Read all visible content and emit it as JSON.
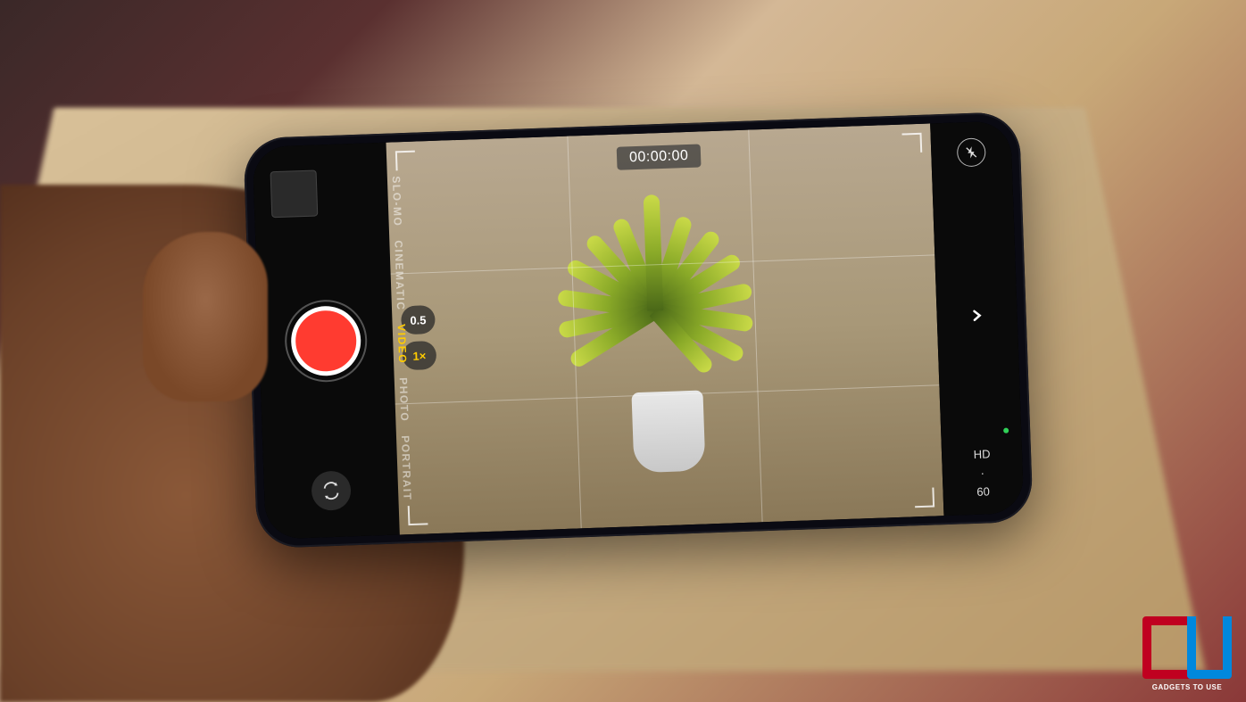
{
  "camera": {
    "timer": "00:00:00",
    "modes": {
      "slomo": "SLO-MO",
      "cinematic": "CINEMATIC",
      "video": "VIDEO",
      "photo": "PHOTO",
      "portrait": "PORTRAIT"
    },
    "zoom": {
      "ultrawide": "0.5",
      "wide": "1×"
    },
    "quality": {
      "resolution": "HD",
      "separator": "·",
      "fps": "60"
    }
  },
  "watermark": {
    "text": "GADGETS TO USE"
  }
}
